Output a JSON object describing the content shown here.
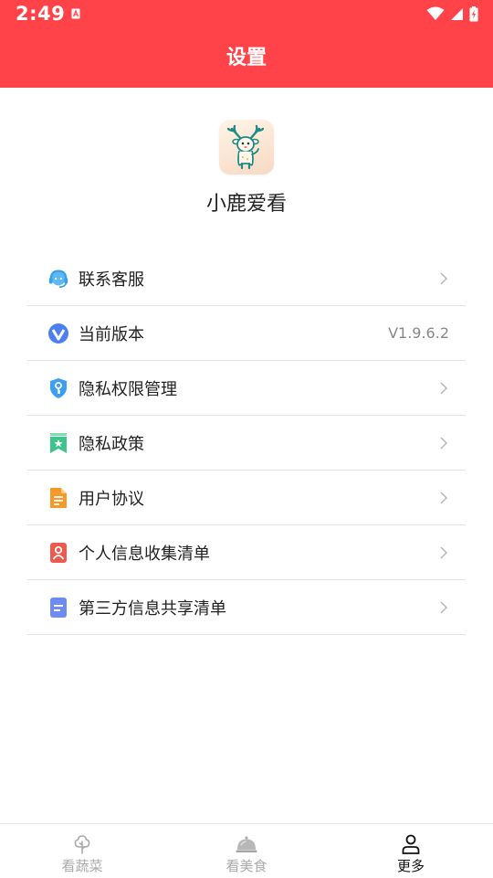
{
  "status_bar": {
    "time": "2:49",
    "notification_icon": "a-notification-icon",
    "wifi_icon": "wifi-icon",
    "signal_icon": "cell-signal-icon",
    "battery_icon": "battery-charging-icon"
  },
  "header": {
    "title": "设置",
    "background_color": "#ff4349"
  },
  "app": {
    "logo_icon": "deer-logo-icon",
    "name": "小鹿爱看"
  },
  "menu": {
    "items": [
      {
        "label": "联系客服",
        "icon": "headset-service-icon",
        "value": "",
        "has_chevron": true
      },
      {
        "label": "当前版本",
        "icon": "version-v-icon",
        "value": "V1.9.6.2",
        "has_chevron": false
      },
      {
        "label": "隐私权限管理",
        "icon": "shield-key-icon",
        "value": "",
        "has_chevron": true
      },
      {
        "label": "隐私政策",
        "icon": "bookmark-star-icon",
        "value": "",
        "has_chevron": true
      },
      {
        "label": "用户协议",
        "icon": "document-icon",
        "value": "",
        "has_chevron": true
      },
      {
        "label": "个人信息收集清单",
        "icon": "person-card-icon",
        "value": "",
        "has_chevron": true
      },
      {
        "label": "第三方信息共享清单",
        "icon": "file-list-icon",
        "value": "",
        "has_chevron": true
      }
    ]
  },
  "tabbar": {
    "tabs": [
      {
        "label": "看蔬菜",
        "icon": "tree-icon",
        "active": false
      },
      {
        "label": "看美食",
        "icon": "food-cloche-icon",
        "active": false
      },
      {
        "label": "更多",
        "icon": "person-icon",
        "active": true
      }
    ],
    "active_color": "#111111",
    "inactive_color": "#aaaaaa"
  }
}
